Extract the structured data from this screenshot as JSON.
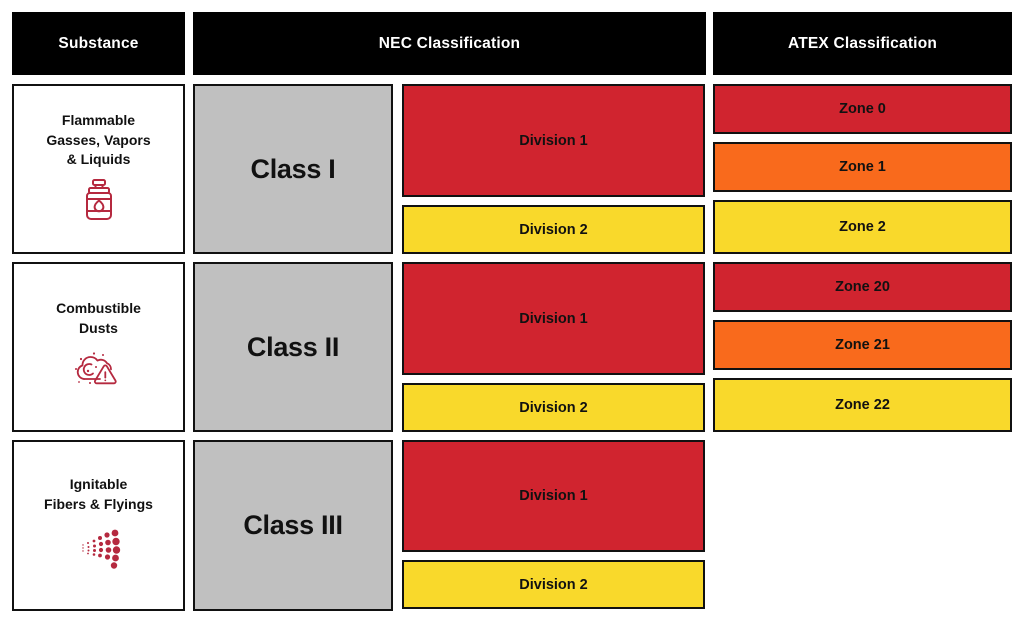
{
  "header": {
    "substance": "Substance",
    "nec": "NEC Classification",
    "atex": "ATEX Classification"
  },
  "colors": {
    "header_bg": "#000000",
    "header_text": "#ffffff",
    "class_bg": "#c0c0c0",
    "red": "#d0242f",
    "orange": "#f96a1c",
    "yellow": "#f9d92b",
    "border": "#111111",
    "icon_red": "#b5293f",
    "page_bg": "#ffffff"
  },
  "rows": [
    {
      "substance": "Flammable\nGasses, Vapors\n& Liquids",
      "icon": "gas-cylinder-flame-icon",
      "nec_class": "Class I",
      "divisions": [
        {
          "label": "Division 1",
          "color": "#d0242f"
        },
        {
          "label": "Division 2",
          "color": "#f9d92b"
        }
      ],
      "zones": [
        {
          "label": "Zone 0",
          "color": "#d0242f"
        },
        {
          "label": "Zone 1",
          "color": "#f96a1c"
        },
        {
          "label": "Zone 2",
          "color": "#f9d92b"
        }
      ]
    },
    {
      "substance": "Combustible\nDusts",
      "icon": "dust-cloud-warning-icon",
      "nec_class": "Class II",
      "divisions": [
        {
          "label": "Division 1",
          "color": "#d0242f"
        },
        {
          "label": "Division 2",
          "color": "#f9d92b"
        }
      ],
      "zones": [
        {
          "label": "Zone 20",
          "color": "#d0242f"
        },
        {
          "label": "Zone 21",
          "color": "#f96a1c"
        },
        {
          "label": "Zone 22",
          "color": "#f9d92b"
        }
      ]
    },
    {
      "substance": "Ignitable\nFibers & Flyings",
      "icon": "fibers-flyings-icon",
      "nec_class": "Class III",
      "divisions": [
        {
          "label": "Division 1",
          "color": "#d0242f"
        },
        {
          "label": "Division 2",
          "color": "#f9d92b"
        }
      ],
      "zones": []
    }
  ]
}
